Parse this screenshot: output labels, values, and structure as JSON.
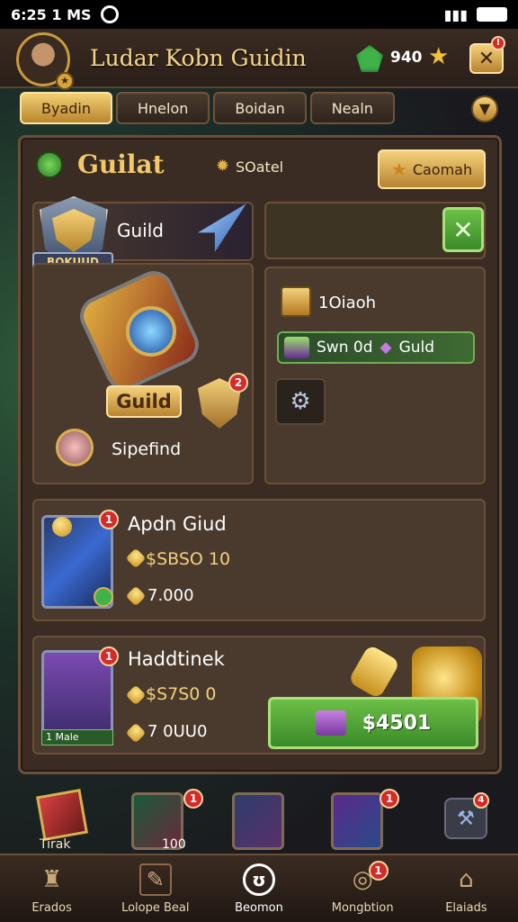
{
  "status": {
    "time": "6:25 1 MS"
  },
  "header": {
    "title": "Ludar Kobn Guidin",
    "gem_count": "940"
  },
  "tabs": [
    {
      "label": "Byadin"
    },
    {
      "label": "Hnelon"
    },
    {
      "label": "Boidan"
    },
    {
      "label": "Nealn"
    }
  ],
  "guild_panel": {
    "heading": "Guilat",
    "status_text": "SOatel",
    "action_button": "Caomah",
    "emblem": {
      "label": "Guild",
      "badge": "BOKUUD"
    },
    "main_item": {
      "label": "Guild",
      "caption": "Sipefind",
      "badge_count": "2"
    },
    "side": {
      "item1": "1Oiaoh",
      "item2_a": "Swn 0d",
      "item2_b": "Guld"
    }
  },
  "offers": [
    {
      "title": "Apdn Giud",
      "price": "$SBSO 10",
      "amount": "7.000",
      "badge": "1"
    },
    {
      "title": "Haddtinek",
      "price": "$S7S0 0",
      "amount": "7 0UU0",
      "badge": "1",
      "tag": "1 Male",
      "buy_label": "$4501"
    }
  ],
  "cards": [
    {
      "label": "Tirak"
    },
    {
      "label": "100",
      "badge": "1"
    },
    {
      "label": "",
      "badge": ""
    },
    {
      "label": "",
      "badge": "1"
    },
    {
      "label": "",
      "badge": "4"
    }
  ],
  "nav": [
    {
      "label": "Erados"
    },
    {
      "label": "Lolope Beal"
    },
    {
      "label": "Beomon"
    },
    {
      "label": "Mongbtion",
      "badge": "1"
    },
    {
      "label": "Elaiads"
    }
  ],
  "colors": {
    "accent_gold": "#f4d07a",
    "accent_green": "#3fb24a",
    "panel": "#3a2c22",
    "badge_red": "#d42a2a"
  }
}
